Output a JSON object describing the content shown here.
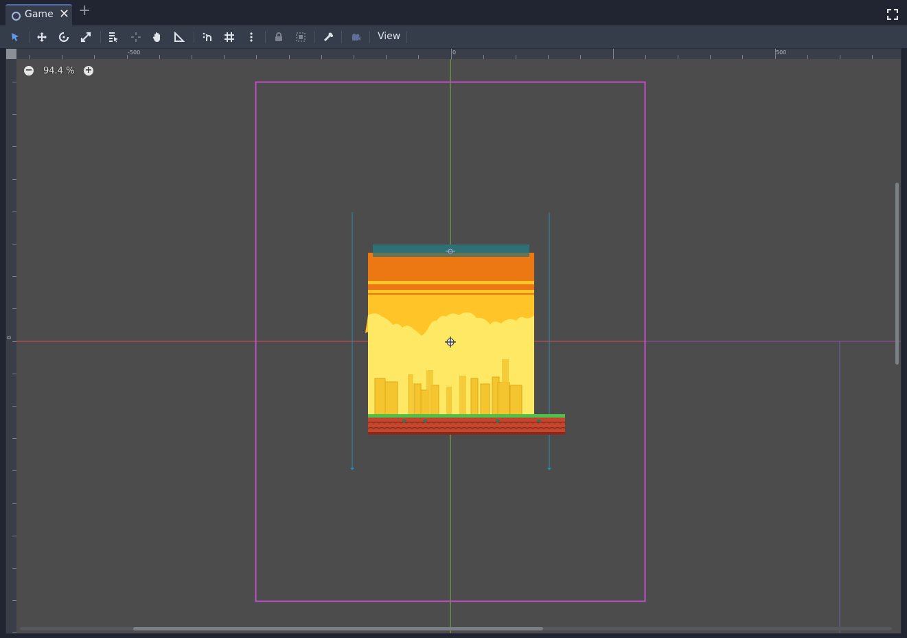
{
  "tabs": [
    {
      "label": "Game",
      "closable": true
    }
  ],
  "new_tab_icon": "plus-icon",
  "toolbar": {
    "tools": [
      "select-icon",
      "move-icon",
      "rotate-icon",
      "scale-icon",
      "list-select-icon",
      "pivot-icon",
      "pan-icon",
      "ruler-icon",
      "smart-snap-icon",
      "grid-snap-icon",
      "more-options-icon",
      "lock-icon",
      "group-icon",
      "skeleton-icon",
      "camera-icon"
    ],
    "view_label": "View"
  },
  "zoom": {
    "level": "94.4 %"
  },
  "rulers": {
    "top_labels": [
      "-500",
      "0",
      "500"
    ],
    "left_labels": [
      "0"
    ]
  },
  "colors": {
    "accent": "#4f6fb0",
    "viewport_bg": "#4c4c4c",
    "frame_border": "#c150c6",
    "axis_x": "#d24b5a",
    "axis_y": "#7fb342",
    "sky_orange": "#ec7813",
    "sky_yellow": "#ffc428",
    "ground": "#c2452d",
    "grass": "#4ec24a"
  }
}
